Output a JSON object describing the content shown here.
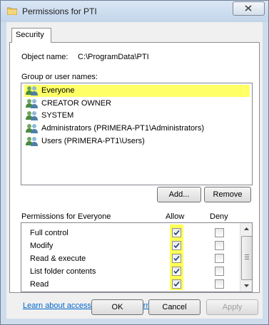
{
  "window": {
    "title": "Permissions for PTI"
  },
  "tabs": [
    {
      "label": "Security"
    }
  ],
  "object": {
    "label": "Object name:",
    "value": "C:\\ProgramData\\PTI"
  },
  "group": {
    "label": "Group or user names:",
    "items": [
      {
        "label": "Everyone",
        "selected": true
      },
      {
        "label": "CREATOR OWNER"
      },
      {
        "label": "SYSTEM"
      },
      {
        "label": "Administrators (PRIMERA-PT1\\Administrators)"
      },
      {
        "label": "Users (PRIMERA-PT1\\Users)"
      }
    ]
  },
  "buttons": {
    "add": "Add...",
    "remove": "Remove",
    "ok": "OK",
    "cancel": "Cancel",
    "apply": "Apply"
  },
  "permissions": {
    "header": "Permissions for Everyone",
    "allow_label": "Allow",
    "deny_label": "Deny",
    "rows": [
      {
        "name": "Full control",
        "allow": true,
        "deny": false
      },
      {
        "name": "Modify",
        "allow": true,
        "deny": false
      },
      {
        "name": "Read & execute",
        "allow": true,
        "deny": false
      },
      {
        "name": "List folder contents",
        "allow": true,
        "deny": false
      },
      {
        "name": "Read",
        "allow": true,
        "deny": false
      }
    ]
  },
  "link": "Learn about access control and permissions",
  "colors": {
    "highlight": "#ffff66",
    "link": "#0066cc",
    "window_frame": "#cfdcec"
  }
}
